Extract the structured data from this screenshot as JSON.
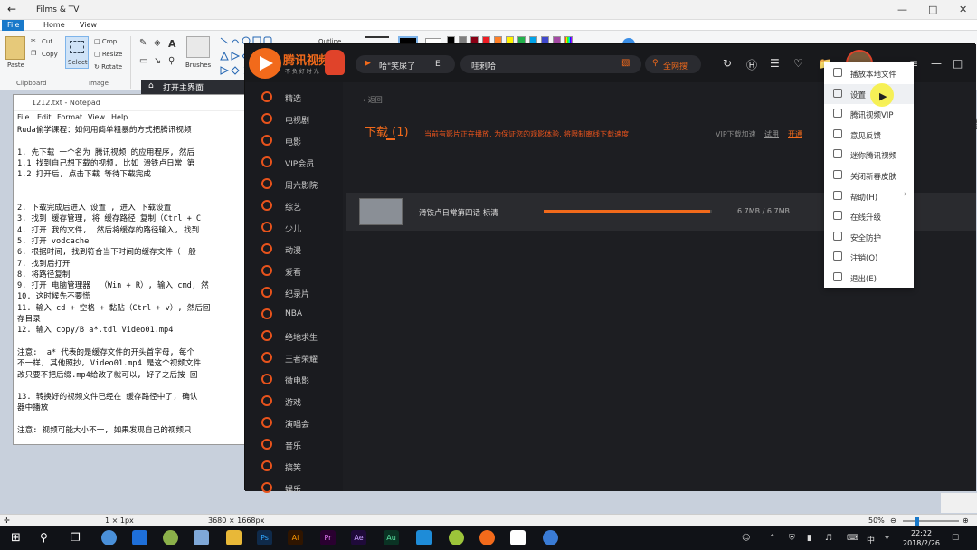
{
  "films_tv": {
    "title": "Films & TV"
  },
  "paint": {
    "tabs": [
      "File",
      "Home",
      "View"
    ],
    "clipboard": {
      "paste": "Paste",
      "cut": "Cut",
      "copy": "Copy",
      "group": "Clipboard"
    },
    "image": {
      "select": "Select",
      "crop": "Crop",
      "resize": "Resize",
      "rotate": "Rotate",
      "group": "Image"
    },
    "brushes": "Brushes",
    "outline": "Outline",
    "status": {
      "size1": "1 × 1px",
      "size2": "3680 × 1668px",
      "zoom": "50%"
    }
  },
  "notepad": {
    "title": "1212.txt - Notepad",
    "menu": [
      "File",
      "Edit",
      "Format",
      "View",
      "Help"
    ],
    "lines": [
      "Ruda偷学课程：如何用简单粗暴的方式把腾讯视频",
      "",
      "1. 先下载 一个名为 腾讯视频 的应用程序, 然后",
      "1.1 找到自己想下载的视频, 比如 滑铁卢日常 第",
      "1.2 打开后, 点击下载 等待下载完成",
      "",
      "",
      "2. 下载完成后进入 设置 , 进入 下载设置",
      "3. 找到 缓存管理, 将 缓存路径 复制（Ctrl + C",
      "4. 打开 我的文件,  然后将缓存的路径输入, 找到",
      "5. 打开 vodcache",
      "6. 根据时间, 找到符合当下时间的缓存文件（一般",
      "7. 找到后打开",
      "8. 将路径复制",
      "9. 打开 电脑管理器  （Win + R）, 输入 cmd, 然",
      "10. 这时候先不要慌",
      "11. 输入 cd + 空格 + 黏贴（Ctrl + v）, 然后回",
      "存目录",
      "12. 输入 copy/B a*.tdl Video01.mp4",
      "",
      "注意:  a* 代表的是缓存文件的开头首字母, 每个",
      "不一样, 其他照抄, Video01.mp4 是这个视频文件",
      "改只要不把后缀.mp4给改了就可以, 好了之后按 回",
      "",
      "13. 转换好的视频文件已经在 缓存路径中了, 确认",
      "器中播放",
      "",
      "注意: 视频可能大小不一, 如果发现自己的视频只"
    ]
  },
  "open_main": "打开主界面",
  "tencent": {
    "logo": "腾讯视频",
    "logo_sub": "不 负 好 时 光",
    "now_playing": "哈\"笑尿了",
    "now_playing_tail": "E",
    "search_value": "哇剌哈",
    "search_button": "全网搜",
    "sidebar": [
      "精选",
      "电视剧",
      "电影",
      "VIP会员",
      "周六影院",
      "综艺",
      "少儿",
      "动漫",
      "爱看",
      "纪录片",
      "NBA",
      "绝地求生",
      "王者荣耀",
      "微电影",
      "游戏",
      "演唱会",
      "音乐",
      "搞笑",
      "娱乐"
    ],
    "back": "返回",
    "download_title": "下载",
    "download_count": "(1)",
    "notice": "当前有影片正在播放, 为保证您的观影体验, 将限制离线下载速度",
    "vip_accel": "VIP下载加速",
    "trial": "试用",
    "open": "开通",
    "item": {
      "title": "滑铁卢日常第四话 标清",
      "size": "6.7MB / 6.7MB",
      "progress": 0.99
    }
  },
  "menu": [
    "播放本地文件",
    "设置",
    "腾讯视频VIP",
    "意见反馈",
    "迷你腾讯视频",
    "关闭新春皮肤",
    "帮助(H)",
    "在线升级",
    "安全防护",
    "注销(O)",
    "退出(E)"
  ],
  "clock": {
    "time": "22:22",
    "date": "2018/2/26"
  },
  "tray": {
    "ime": "中"
  },
  "colors": {
    "accent": "#f26a1b",
    "highlight": "#f7f03a"
  }
}
